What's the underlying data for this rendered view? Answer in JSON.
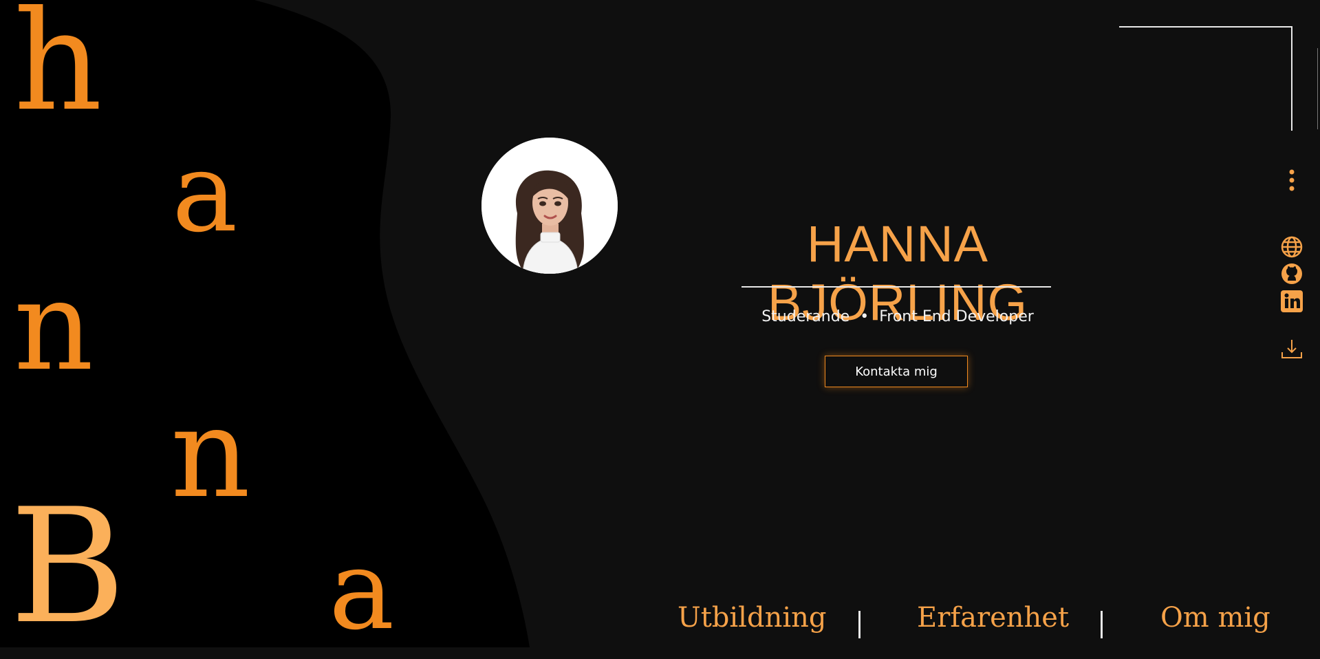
{
  "background_letters": [
    "h",
    "a",
    "n",
    "n",
    "B",
    "a"
  ],
  "profile": {
    "name": "HANNA BJÖRLING",
    "role_1": "Studerande",
    "separator": "•",
    "role_2": "Front End Developer",
    "contact_label": "Kontakta mig"
  },
  "side_icons": [
    "more-vertical-icon",
    "globe-icon",
    "github-icon",
    "linkedin-icon",
    "download-icon"
  ],
  "footer_nav": {
    "education": "Utbildning",
    "experience": "Erfarenhet",
    "about": "Om mig"
  },
  "colors": {
    "accent": "#f28a1f",
    "accent_light": "#f6a249",
    "background": "#0f0f0f",
    "blob": "#000000",
    "text": "#ffffff"
  }
}
